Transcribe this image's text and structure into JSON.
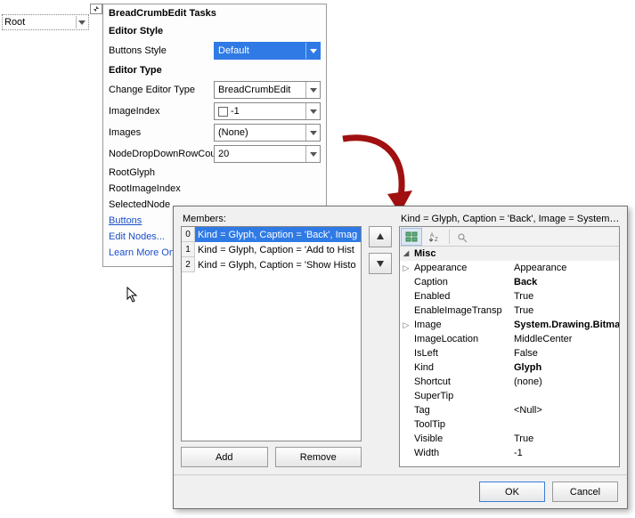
{
  "root_field": {
    "value": "Root"
  },
  "tasks": {
    "title": "BreadCrumbEdit Tasks",
    "editor_style_label": "Editor Style",
    "buttons_style_label": "Buttons Style",
    "buttons_style_value": "Default",
    "editor_type_label": "Editor Type",
    "change_editor_type_label": "Change Editor Type",
    "change_editor_type_value": "BreadCrumbEdit",
    "image_index_label": "ImageIndex",
    "image_index_value": "-1",
    "images_label": "Images",
    "images_value": "(None)",
    "node_dd_row_count_label": "NodeDropDownRowCount",
    "node_dd_row_count_value": "20",
    "root_glyph_label": "RootGlyph",
    "root_image_index_label": "RootImageIndex",
    "selected_node_label": "SelectedNode",
    "buttons_link": "Buttons",
    "edit_nodes_link": "Edit Nodes...",
    "learn_more_link": "Learn More Online"
  },
  "editor": {
    "members_label": "Members:",
    "items": [
      {
        "idx": "0",
        "text": "Kind = Glyph, Caption = 'Back', Imag"
      },
      {
        "idx": "1",
        "text": "Kind = Glyph, Caption = 'Add to Hist"
      },
      {
        "idx": "2",
        "text": "Kind = Glyph, Caption = 'Show Histo"
      }
    ],
    "add_label": "Add",
    "remove_label": "Remove",
    "selection_label": "Kind = Glyph, Caption = 'Back', Image = System.D...",
    "category": "Misc",
    "props": [
      {
        "name": "Appearance",
        "value": "Appearance",
        "expandable": true
      },
      {
        "name": "Caption",
        "value": "Back",
        "bold": true
      },
      {
        "name": "Enabled",
        "value": "True"
      },
      {
        "name": "EnableImageTransp",
        "value": "True"
      },
      {
        "name": "Image",
        "value": "System.Drawing.Bitmap",
        "bold": true,
        "expandable": true
      },
      {
        "name": "ImageLocation",
        "value": "MiddleCenter"
      },
      {
        "name": "IsLeft",
        "value": "False"
      },
      {
        "name": "Kind",
        "value": "Glyph",
        "bold": true
      },
      {
        "name": "Shortcut",
        "value": "(none)"
      },
      {
        "name": "SuperTip",
        "value": ""
      },
      {
        "name": "Tag",
        "value": "<Null>"
      },
      {
        "name": "ToolTip",
        "value": ""
      },
      {
        "name": "Visible",
        "value": "True"
      },
      {
        "name": "Width",
        "value": "-1"
      }
    ],
    "ok_label": "OK",
    "cancel_label": "Cancel"
  }
}
